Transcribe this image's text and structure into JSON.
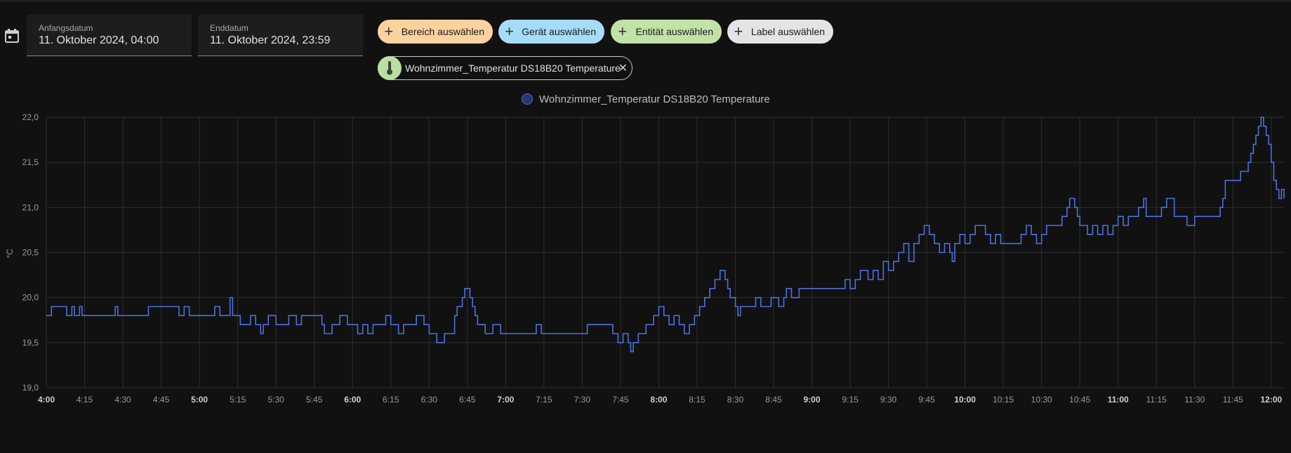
{
  "date_range": {
    "start_label": "Anfangsdatum",
    "start_value": "11. Oktober 2024, 04:00",
    "end_label": "Enddatum",
    "end_value": "11. Oktober 2024, 23:59"
  },
  "target_chips": [
    {
      "label": "Bereich auswählen",
      "color": "#fcd29f"
    },
    {
      "label": "Gerät auswählen",
      "color": "#a6dcf8"
    },
    {
      "label": "Entität auswählen",
      "color": "#c2e3a8"
    },
    {
      "label": "Label auswählen",
      "color": "#e4e4e4"
    }
  ],
  "selected_entity": {
    "label": "Wohnzimmer_Temperatur DS18B20 Temperature",
    "icon": "thermometer-icon",
    "close_icon": "close-icon"
  },
  "colors": {
    "line": "#4c71dd",
    "grid": "#2e2e2e",
    "background": "#111111"
  },
  "chart_data": {
    "type": "line",
    "series": [
      {
        "name": "Wohnzimmer_Temperatur DS18B20 Temperature"
      }
    ],
    "ylabel": "°C",
    "ylim": [
      19.0,
      22.0
    ],
    "y_ticks": [
      "22,0",
      "21,5",
      "21,0",
      "20,5",
      "20,0",
      "19,5",
      "19,0"
    ],
    "xlim": [
      "4:00",
      "12:05"
    ],
    "x_ticks": [
      {
        "label": "4:00",
        "bold": true
      },
      {
        "label": "4:15"
      },
      {
        "label": "4:30"
      },
      {
        "label": "4:45"
      },
      {
        "label": "5:00",
        "bold": true
      },
      {
        "label": "5:15"
      },
      {
        "label": "5:30"
      },
      {
        "label": "5:45"
      },
      {
        "label": "6:00",
        "bold": true
      },
      {
        "label": "6:15"
      },
      {
        "label": "6:30"
      },
      {
        "label": "6:45"
      },
      {
        "label": "7:00",
        "bold": true
      },
      {
        "label": "7:15"
      },
      {
        "label": "7:30"
      },
      {
        "label": "7:45"
      },
      {
        "label": "8:00",
        "bold": true
      },
      {
        "label": "8:15"
      },
      {
        "label": "8:30"
      },
      {
        "label": "8:45"
      },
      {
        "label": "9:00",
        "bold": true
      },
      {
        "label": "9:15"
      },
      {
        "label": "9:30"
      },
      {
        "label": "9:45"
      },
      {
        "label": "10:00",
        "bold": true
      },
      {
        "label": "10:15"
      },
      {
        "label": "10:30"
      },
      {
        "label": "10:45"
      },
      {
        "label": "11:00",
        "bold": true
      },
      {
        "label": "11:15"
      },
      {
        "label": "11:30"
      },
      {
        "label": "11:45"
      },
      {
        "label": "12:00",
        "bold": true
      }
    ],
    "step": true,
    "grid": true,
    "legend": "top-center",
    "points": [
      [
        "4:00",
        19.8
      ],
      [
        "4:02",
        19.9
      ],
      [
        "4:08",
        19.8
      ],
      [
        "4:10",
        19.9
      ],
      [
        "4:11",
        19.8
      ],
      [
        "4:13",
        19.9
      ],
      [
        "4:14",
        19.8
      ],
      [
        "4:16",
        19.8
      ],
      [
        "4:20",
        19.8
      ],
      [
        "4:25",
        19.8
      ],
      [
        "4:27",
        19.9
      ],
      [
        "4:28",
        19.8
      ],
      [
        "4:32",
        19.8
      ],
      [
        "4:38",
        19.8
      ],
      [
        "4:40",
        19.9
      ],
      [
        "4:50",
        19.9
      ],
      [
        "4:52",
        19.8
      ],
      [
        "4:54",
        19.9
      ],
      [
        "4:56",
        19.8
      ],
      [
        "4:58",
        19.8
      ],
      [
        "5:03",
        19.8
      ],
      [
        "5:06",
        19.9
      ],
      [
        "5:08",
        19.8
      ],
      [
        "5:12",
        20.0
      ],
      [
        "5:13",
        19.8
      ],
      [
        "5:15",
        19.8
      ],
      [
        "5:16",
        19.7
      ],
      [
        "5:20",
        19.8
      ],
      [
        "5:22",
        19.7
      ],
      [
        "5:24",
        19.6
      ],
      [
        "5:25",
        19.7
      ],
      [
        "5:27",
        19.8
      ],
      [
        "5:30",
        19.7
      ],
      [
        "5:35",
        19.8
      ],
      [
        "5:38",
        19.7
      ],
      [
        "5:40",
        19.8
      ],
      [
        "5:47",
        19.8
      ],
      [
        "5:48",
        19.7
      ],
      [
        "5:49",
        19.6
      ],
      [
        "5:52",
        19.7
      ],
      [
        "5:55",
        19.8
      ],
      [
        "5:58",
        19.7
      ],
      [
        "6:02",
        19.6
      ],
      [
        "6:04",
        19.7
      ],
      [
        "6:06",
        19.6
      ],
      [
        "6:08",
        19.7
      ],
      [
        "6:13",
        19.8
      ],
      [
        "6:15",
        19.7
      ],
      [
        "6:18",
        19.6
      ],
      [
        "6:20",
        19.7
      ],
      [
        "6:25",
        19.8
      ],
      [
        "6:28",
        19.7
      ],
      [
        "6:30",
        19.6
      ],
      [
        "6:33",
        19.5
      ],
      [
        "6:36",
        19.6
      ],
      [
        "6:40",
        19.8
      ],
      [
        "6:41",
        19.9
      ],
      [
        "6:43",
        20.0
      ],
      [
        "6:44",
        20.1
      ],
      [
        "6:46",
        20.0
      ],
      [
        "6:47",
        19.9
      ],
      [
        "6:48",
        19.8
      ],
      [
        "6:49",
        19.7
      ],
      [
        "6:52",
        19.6
      ],
      [
        "6:55",
        19.7
      ],
      [
        "6:58",
        19.6
      ],
      [
        "7:10",
        19.6
      ],
      [
        "7:12",
        19.7
      ],
      [
        "7:14",
        19.6
      ],
      [
        "7:30",
        19.6
      ],
      [
        "7:32",
        19.7
      ],
      [
        "7:40",
        19.7
      ],
      [
        "7:42",
        19.6
      ],
      [
        "7:44",
        19.5
      ],
      [
        "7:46",
        19.6
      ],
      [
        "7:48",
        19.5
      ],
      [
        "7:49",
        19.4
      ],
      [
        "7:50",
        19.5
      ],
      [
        "7:52",
        19.6
      ],
      [
        "7:55",
        19.7
      ],
      [
        "7:58",
        19.8
      ],
      [
        "8:00",
        19.9
      ],
      [
        "8:02",
        19.8
      ],
      [
        "8:04",
        19.7
      ],
      [
        "8:06",
        19.8
      ],
      [
        "8:08",
        19.7
      ],
      [
        "8:10",
        19.6
      ],
      [
        "8:12",
        19.7
      ],
      [
        "8:14",
        19.8
      ],
      [
        "8:16",
        19.9
      ],
      [
        "8:18",
        20.0
      ],
      [
        "8:20",
        20.1
      ],
      [
        "8:22",
        20.2
      ],
      [
        "8:24",
        20.3
      ],
      [
        "8:26",
        20.2
      ],
      [
        "8:27",
        20.1
      ],
      [
        "8:28",
        20.0
      ],
      [
        "8:30",
        19.9
      ],
      [
        "8:31",
        19.8
      ],
      [
        "8:32",
        19.9
      ],
      [
        "8:37",
        19.9
      ],
      [
        "8:38",
        20.0
      ],
      [
        "8:40",
        19.9
      ],
      [
        "8:44",
        20.0
      ],
      [
        "8:47",
        19.9
      ],
      [
        "8:49",
        20.0
      ],
      [
        "8:50",
        20.1
      ],
      [
        "8:52",
        20.0
      ],
      [
        "8:55",
        20.1
      ],
      [
        "9:00",
        20.1
      ],
      [
        "9:10",
        20.1
      ],
      [
        "9:13",
        20.2
      ],
      [
        "9:15",
        20.1
      ],
      [
        "9:17",
        20.2
      ],
      [
        "9:19",
        20.3
      ],
      [
        "9:22",
        20.2
      ],
      [
        "9:24",
        20.3
      ],
      [
        "9:26",
        20.2
      ],
      [
        "9:28",
        20.4
      ],
      [
        "9:30",
        20.3
      ],
      [
        "9:32",
        20.4
      ],
      [
        "9:34",
        20.5
      ],
      [
        "9:36",
        20.6
      ],
      [
        "9:38",
        20.4
      ],
      [
        "9:40",
        20.6
      ],
      [
        "9:42",
        20.7
      ],
      [
        "9:44",
        20.8
      ],
      [
        "9:46",
        20.7
      ],
      [
        "9:48",
        20.6
      ],
      [
        "9:50",
        20.5
      ],
      [
        "9:52",
        20.6
      ],
      [
        "9:54",
        20.5
      ],
      [
        "9:55",
        20.4
      ],
      [
        "9:56",
        20.6
      ],
      [
        "9:58",
        20.7
      ],
      [
        "10:00",
        20.6
      ],
      [
        "10:02",
        20.7
      ],
      [
        "10:04",
        20.8
      ],
      [
        "10:08",
        20.7
      ],
      [
        "10:10",
        20.6
      ],
      [
        "10:12",
        20.7
      ],
      [
        "10:14",
        20.6
      ],
      [
        "10:20",
        20.6
      ],
      [
        "10:22",
        20.7
      ],
      [
        "10:24",
        20.8
      ],
      [
        "10:26",
        20.7
      ],
      [
        "10:28",
        20.6
      ],
      [
        "10:30",
        20.7
      ],
      [
        "10:32",
        20.8
      ],
      [
        "10:35",
        20.8
      ],
      [
        "10:38",
        20.9
      ],
      [
        "10:40",
        21.0
      ],
      [
        "10:41",
        21.1
      ],
      [
        "10:43",
        21.0
      ],
      [
        "10:44",
        20.9
      ],
      [
        "10:45",
        20.8
      ],
      [
        "10:48",
        20.7
      ],
      [
        "10:50",
        20.8
      ],
      [
        "10:52",
        20.7
      ],
      [
        "10:54",
        20.8
      ],
      [
        "10:56",
        20.7
      ],
      [
        "10:58",
        20.8
      ],
      [
        "11:00",
        20.9
      ],
      [
        "11:02",
        20.8
      ],
      [
        "11:04",
        20.9
      ],
      [
        "11:06",
        20.9
      ],
      [
        "11:08",
        21.0
      ],
      [
        "11:10",
        21.1
      ],
      [
        "11:11",
        20.9
      ],
      [
        "11:14",
        20.9
      ],
      [
        "11:17",
        21.0
      ],
      [
        "11:19",
        21.1
      ],
      [
        "11:22",
        20.9
      ],
      [
        "11:25",
        20.9
      ],
      [
        "11:27",
        20.8
      ],
      [
        "11:30",
        20.9
      ],
      [
        "11:35",
        20.9
      ],
      [
        "11:40",
        21.0
      ],
      [
        "11:41",
        21.1
      ],
      [
        "11:42",
        21.3
      ],
      [
        "11:45",
        21.3
      ],
      [
        "11:48",
        21.4
      ],
      [
        "11:50",
        21.4
      ],
      [
        "11:51",
        21.5
      ],
      [
        "11:52",
        21.6
      ],
      [
        "11:53",
        21.7
      ],
      [
        "11:54",
        21.8
      ],
      [
        "11:55",
        21.9
      ],
      [
        "11:56",
        22.0
      ],
      [
        "11:57",
        21.9
      ],
      [
        "11:58",
        21.8
      ],
      [
        "11:59",
        21.7
      ],
      [
        "12:00",
        21.5
      ],
      [
        "12:01",
        21.3
      ],
      [
        "12:02",
        21.2
      ],
      [
        "12:03",
        21.1
      ],
      [
        "12:04",
        21.2
      ],
      [
        "12:05",
        21.1
      ]
    ]
  }
}
